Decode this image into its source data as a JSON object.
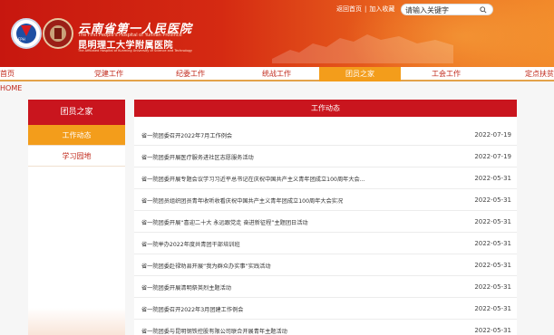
{
  "header": {
    "title_cn": "云南省第一人民医院",
    "title_en": "The First People's Hospital of Yunnan Province",
    "subtitle_cn": "昆明理工大学附属医院",
    "subtitle_en": "The Affiliated Hospital of Kunming University of Science and Technology",
    "logo_text": "FPH",
    "links": {
      "home": "返回首页",
      "favorite": "加入收藏"
    },
    "search_placeholder": "请输入关键字"
  },
  "nav": {
    "items": [
      "首页HOME",
      "党建工作",
      "纪委工作",
      "统战工作",
      "团员之家",
      "工会工作",
      "定点扶贫"
    ],
    "active": "团员之家"
  },
  "sidebar": {
    "title": "团员之家",
    "items": [
      {
        "label": "工作动态",
        "active": true
      },
      {
        "label": "学习园地",
        "active": false
      }
    ]
  },
  "main": {
    "title": "工作动态",
    "rows": [
      {
        "title": "省一院团委召开2022年7月工作例会",
        "date": "2022-07-19"
      },
      {
        "title": "省一院团委开展医疗服务进社区志愿服务活动",
        "date": "2022-07-19"
      },
      {
        "title": "省一院团委开展专题会议学习习近平总书记在庆祝中国共产主义青年团成立100周年大会...",
        "date": "2022-05-31"
      },
      {
        "title": "省一院团员组织团员青年收听收看庆祝中国共产主义青年团成立100周年大会实况",
        "date": "2022-05-31"
      },
      {
        "title": "省一院团委开展“喜迎二十大 永远跟党走 奋进新征程”主题团日活动",
        "date": "2022-05-31"
      },
      {
        "title": "省一院举办2022年度共青团干部培训班",
        "date": "2022-05-31"
      },
      {
        "title": "省一院团委赴禄劝县开展“我为群众办实事”实践活动",
        "date": "2022-05-31"
      },
      {
        "title": "省一院团委开展清明祭英烈主题活动",
        "date": "2022-05-31"
      },
      {
        "title": "省一院团委召开2022年3月团建工作例会",
        "date": "2022-05-31"
      },
      {
        "title": "省一院团委与昆明钢铁控股有限公司联合开展青年主题活动",
        "date": "2022-05-31"
      }
    ]
  },
  "colors": {
    "primary_red": "#c9151e",
    "accent_orange": "#f39d1b"
  }
}
